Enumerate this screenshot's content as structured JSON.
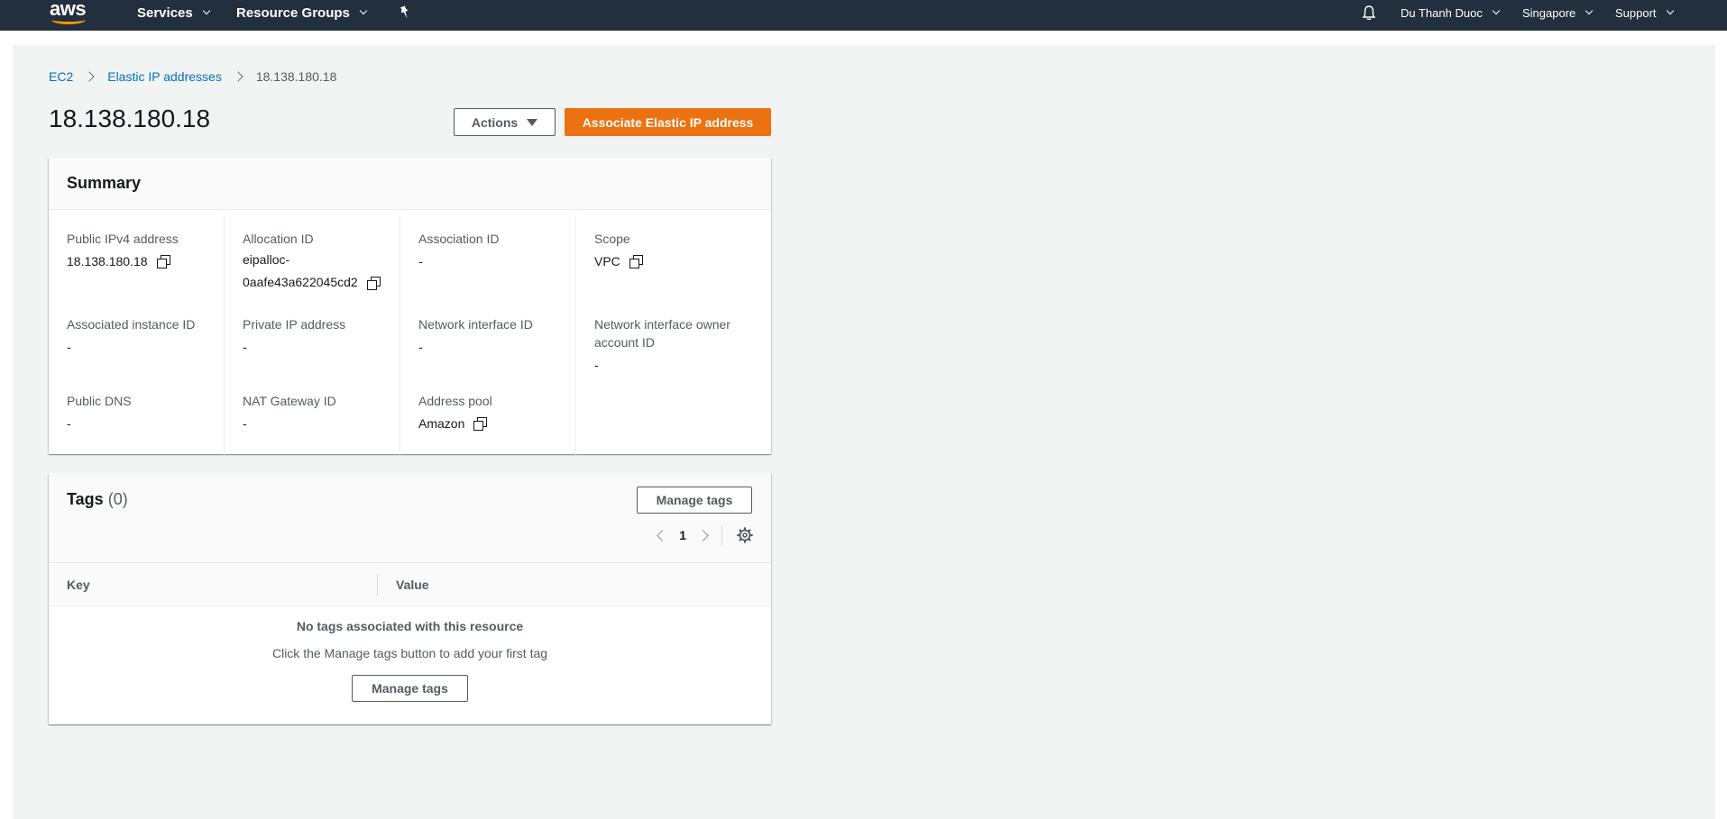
{
  "topnav": {
    "logo": "aws",
    "services": "Services",
    "resource_groups": "Resource Groups",
    "user": "Du Thanh Duoc",
    "region": "Singapore",
    "support": "Support"
  },
  "breadcrumb": {
    "ec2": "EC2",
    "elastic_ips": "Elastic IP addresses",
    "current": "18.138.180.18"
  },
  "page": {
    "title": "18.138.180.18",
    "actions_label": "Actions",
    "associate_label": "Associate Elastic IP address"
  },
  "summary": {
    "title": "Summary",
    "public_ipv4_label": "Public IPv4 address",
    "public_ipv4_value": "18.138.180.18",
    "allocation_id_label": "Allocation ID",
    "allocation_id_value_1": "eipalloc-",
    "allocation_id_value_2": "0aafe43a622045cd2",
    "association_id_label": "Association ID",
    "association_id_value": "-",
    "scope_label": "Scope",
    "scope_value": "VPC",
    "assoc_instance_label": "Associated instance ID",
    "assoc_instance_value": "-",
    "private_ip_label": "Private IP address",
    "private_ip_value": "-",
    "eni_id_label": "Network interface ID",
    "eni_id_value": "-",
    "eni_owner_label": "Network interface owner account ID",
    "eni_owner_value": "-",
    "public_dns_label": "Public DNS",
    "public_dns_value": "-",
    "nat_gw_label": "NAT Gateway ID",
    "nat_gw_value": "-",
    "address_pool_label": "Address pool",
    "address_pool_value": "Amazon"
  },
  "tags": {
    "title": "Tags",
    "count": "(0)",
    "manage_label": "Manage tags",
    "page_number": "1",
    "col_key": "Key",
    "col_value": "Value",
    "empty_title": "No tags associated with this resource",
    "empty_hint": "Click the Manage tags button to add your first tag",
    "empty_manage_label": "Manage tags"
  },
  "colors": {
    "nav_bg": "#232f3e",
    "primary": "#ec7211",
    "link": "#0073bb",
    "page_bg": "#f2f3f3"
  }
}
